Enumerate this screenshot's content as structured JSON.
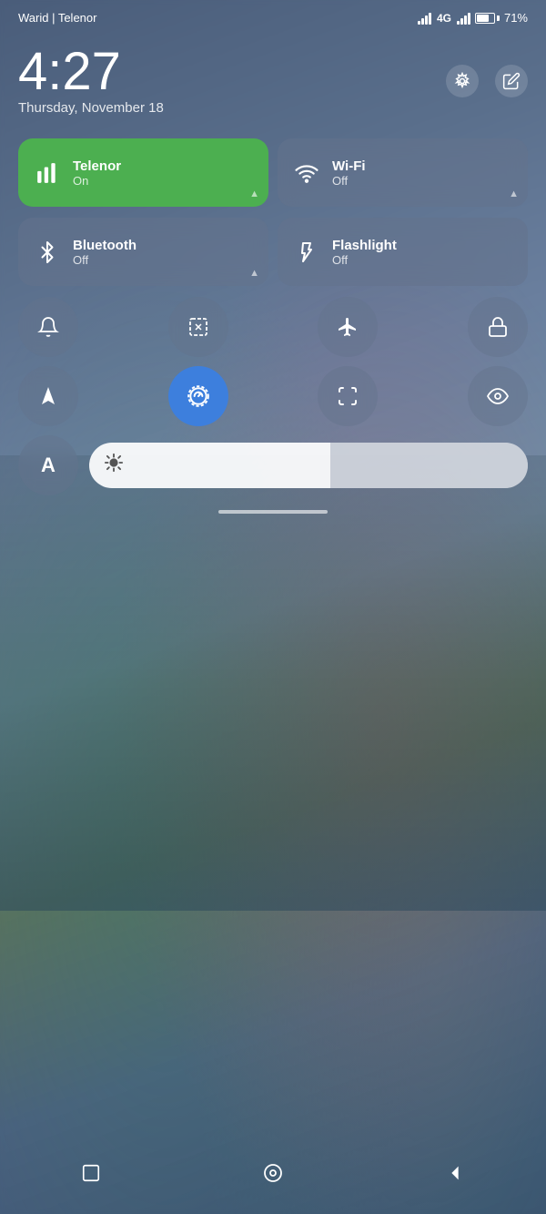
{
  "statusBar": {
    "carrier": "Warid | Telenor",
    "networkType": "4G",
    "batteryPercent": "71%"
  },
  "clock": {
    "time": "4:27",
    "date": "Thursday, November 18"
  },
  "icons": {
    "settings": "⊙",
    "edit": "✏"
  },
  "toggles": [
    {
      "id": "telenor",
      "name": "Telenor",
      "status": "On",
      "active": true,
      "icon": "signal"
    },
    {
      "id": "wifi",
      "name": "Wi-Fi",
      "status": "Off",
      "active": false,
      "icon": "wifi"
    },
    {
      "id": "bluetooth",
      "name": "Bluetooth",
      "status": "Off",
      "active": false,
      "icon": "bluetooth"
    },
    {
      "id": "flashlight",
      "name": "Flashlight",
      "status": "Off",
      "active": false,
      "icon": "flashlight"
    }
  ],
  "quickIcons": [
    {
      "id": "bell",
      "label": "Bell",
      "active": false
    },
    {
      "id": "screenshot",
      "label": "Screenshot",
      "active": false
    },
    {
      "id": "airplane",
      "label": "Airplane Mode",
      "active": false
    },
    {
      "id": "lock",
      "label": "Lock",
      "active": false
    }
  ],
  "quickIcons2": [
    {
      "id": "location",
      "label": "Location",
      "active": false
    },
    {
      "id": "autorotate",
      "label": "Auto Rotate",
      "active": true
    },
    {
      "id": "scan",
      "label": "Scan",
      "active": false
    },
    {
      "id": "eye",
      "label": "Reading Mode",
      "active": false
    }
  ],
  "brightness": {
    "label": "A",
    "level": 55
  },
  "navBar": {
    "recents": "◻",
    "home": "○",
    "back": "◁"
  }
}
